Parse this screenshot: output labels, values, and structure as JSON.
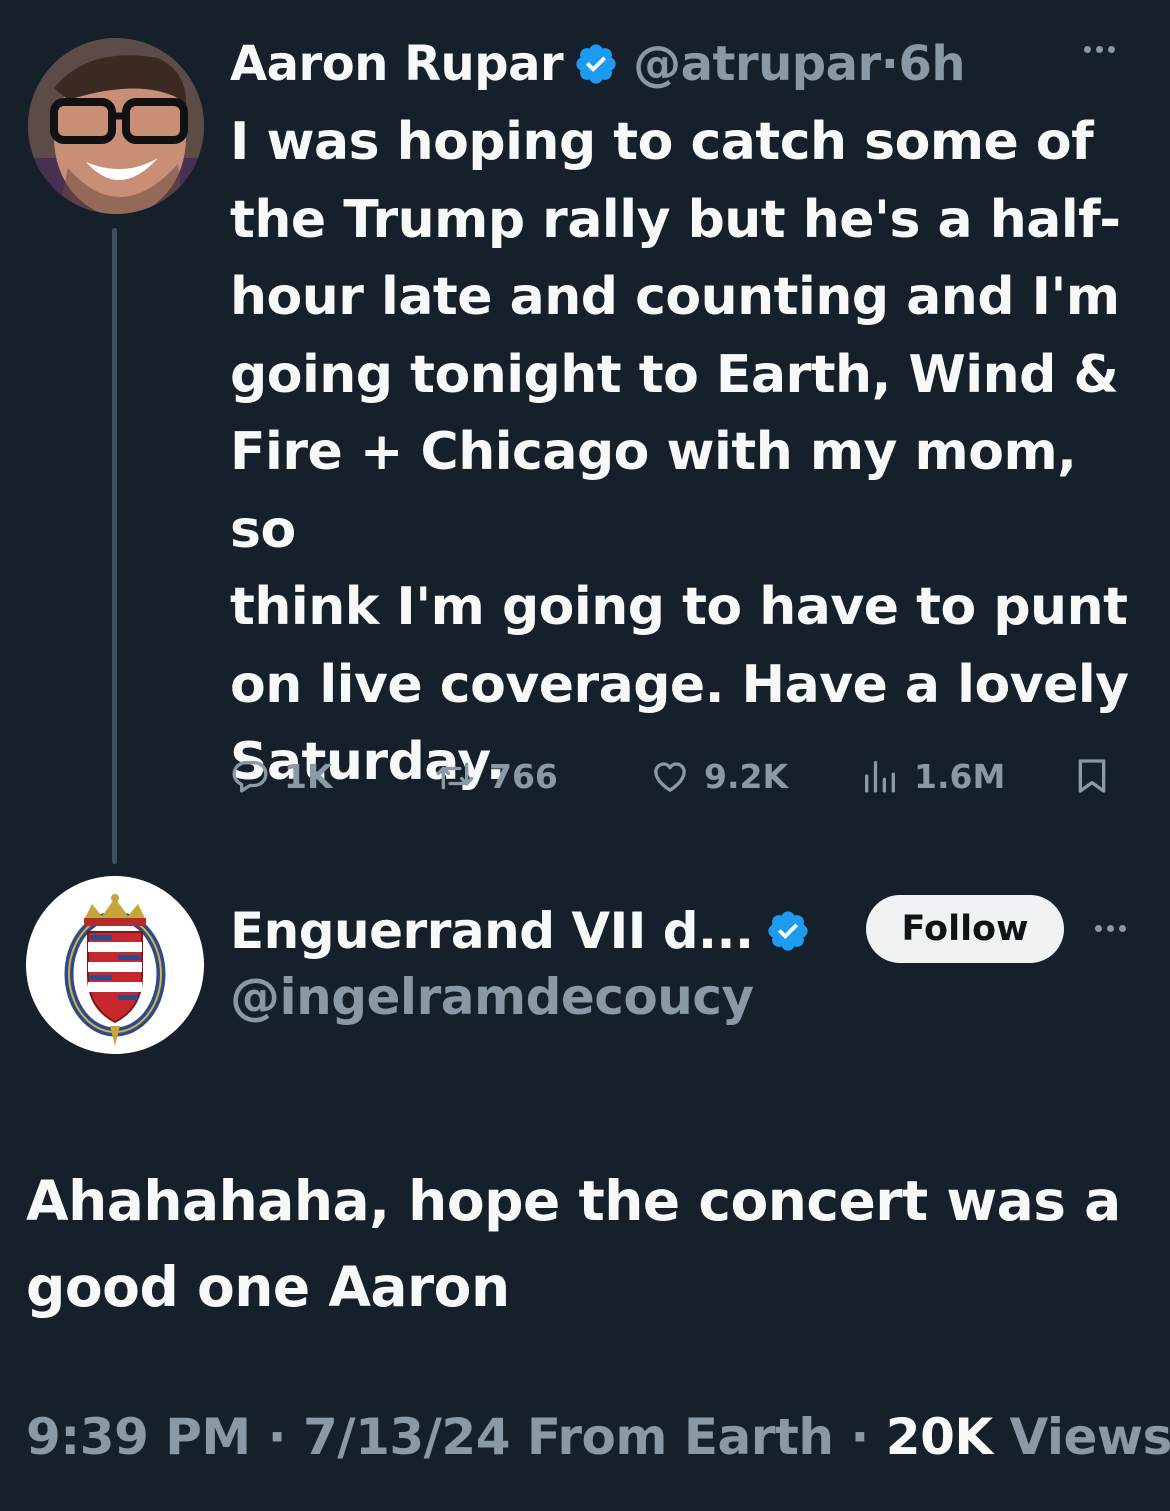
{
  "tweet": {
    "author_name": "Aaron Rupar",
    "author_handle": "@atrupar",
    "time": "6h",
    "text": "I was hoping to catch some of the Trump rally but he's a half-hour late and counting and I'm going tonight to Earth, Wind & Fire + Chicago with my mom, so think I'm going to have to punt on live coverage. Have a lovely Saturday.",
    "lines": [
      "I was hoping to catch some of",
      "the Trump rally but he's a half-",
      "hour late and counting and I'm",
      "going tonight to Earth, Wind &",
      "Fire + Chicago with my mom, so",
      "think I'm going to have to punt",
      "on live coverage. Have a lovely",
      "Saturday."
    ],
    "stats": {
      "replies": "1K",
      "reposts": "766",
      "likes": "9.2K",
      "views": "1.6M"
    }
  },
  "reply": {
    "author_name": "Enguerrand VII d...",
    "author_handle": "@ingelramdecoucy",
    "follow_label": "Follow",
    "lines": [
      "Ahahahaha, hope the concert was a",
      "good one Aaron"
    ],
    "time": "9:39 PM",
    "date": "7/13/24",
    "source": "From Earth",
    "views_count": "20K",
    "views_label": "Views"
  },
  "icons": {
    "verified": "verified-badge-icon",
    "reply": "reply-bubble-icon",
    "repost": "repost-icon",
    "like": "heart-icon",
    "views": "bar-chart-icon",
    "bookmark": "bookmark-icon",
    "more": "more-dots-icon"
  },
  "colors": {
    "background": "#15202b",
    "text": "#f7f9f9",
    "secondary": "#8b98a5",
    "verified": "#1d9bf0"
  }
}
